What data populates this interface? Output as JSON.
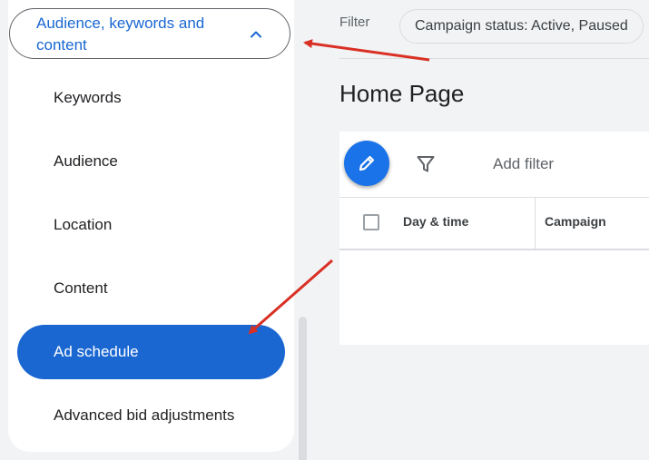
{
  "sidebar": {
    "section_title": "Audience, keywords and content",
    "items": [
      {
        "label": "Keywords"
      },
      {
        "label": "Audience"
      },
      {
        "label": "Location"
      },
      {
        "label": "Content"
      },
      {
        "label": "Ad schedule",
        "active": true
      },
      {
        "label": "Advanced bid adjustments"
      }
    ]
  },
  "filter_bar": {
    "label": "Filter",
    "chip": "Campaign status: Active, Paused"
  },
  "page": {
    "title": "Home Page"
  },
  "table": {
    "add_filter": "Add filter",
    "columns": [
      "Day & time",
      "Campaign"
    ]
  },
  "colors": {
    "accent": "#1a73e8",
    "active_item": "#1a67d2",
    "annotation_arrow": "#d93025"
  },
  "icons": [
    "chevron-up-icon",
    "pencil-icon",
    "filter-icon",
    "checkbox-icon"
  ]
}
